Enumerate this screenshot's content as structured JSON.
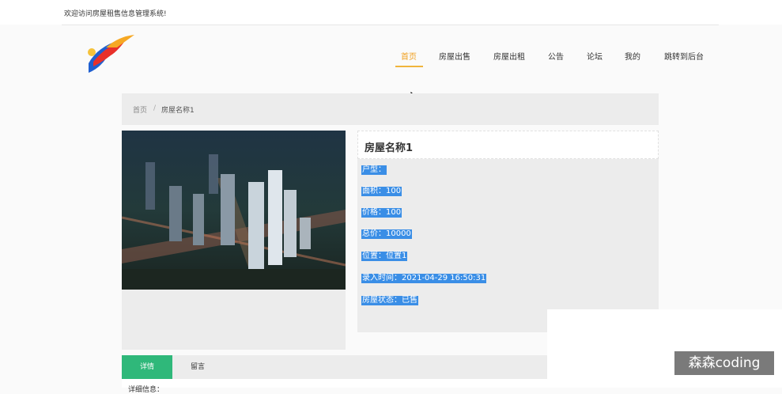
{
  "topbar": {
    "welcome": "欢迎访问房屋租售信息管理系统!"
  },
  "logo": {
    "name": "logo"
  },
  "nav": {
    "items": [
      {
        "label": "首页",
        "active": true
      },
      {
        "label": "房屋出售",
        "active": false
      },
      {
        "label": "房屋出租",
        "active": false
      },
      {
        "label": "公告",
        "active": false
      },
      {
        "label": "论坛",
        "active": false
      },
      {
        "label": "我的",
        "active": false
      },
      {
        "label": "跳转到后台",
        "active": false
      }
    ]
  },
  "breadcrumb": {
    "home": "首页",
    "separator": "/",
    "current": "房屋名称1"
  },
  "house": {
    "title": "房屋名称1",
    "fields": [
      "户型：",
      "面积：100",
      "价格：100",
      "总价：10000",
      "位置：位置1",
      "录入时间：2021-04-29 16:50:31",
      "房屋状态：已售"
    ]
  },
  "tabs": {
    "detail": "详情",
    "comment": "留言"
  },
  "detail_label": "详细信息：",
  "watermark": "森森coding",
  "colors": {
    "accent": "#f0b53c",
    "tab_active": "#2fb87a",
    "selection": "#3a8ee6"
  },
  "icons": {
    "cursor": "mouse-pointer-icon"
  }
}
